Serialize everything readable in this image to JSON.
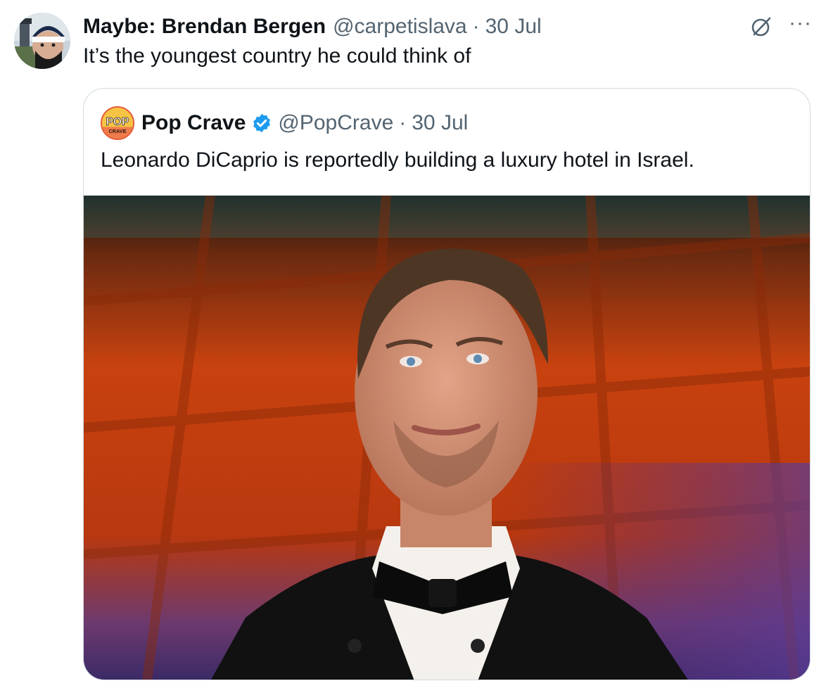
{
  "tweet": {
    "author_name": "Maybe: Brendan Bergen",
    "handle": "@carpetislava",
    "separator": "·",
    "date": "30 Jul",
    "text": "It’s the youngest country he could think of",
    "more_label": "···",
    "icons": {
      "avatar": "profile-avatar",
      "grok": "grok-icon",
      "more": "more-icon"
    }
  },
  "quoted_tweet": {
    "author_name": "Pop Crave",
    "handle": "@PopCrave",
    "separator": "·",
    "date": "30 Jul",
    "text": "Leonardo DiCaprio is reportedly building a luxury hotel in Israel.",
    "avatar_text_top": "POP",
    "avatar_text_bottom": "CRAVE",
    "verified": true,
    "media_alt": "photo"
  },
  "colors": {
    "text_primary": "#0f1419",
    "text_secondary": "#536471",
    "border": "#cfd9de",
    "verified_blue": "#1d9bf0"
  }
}
